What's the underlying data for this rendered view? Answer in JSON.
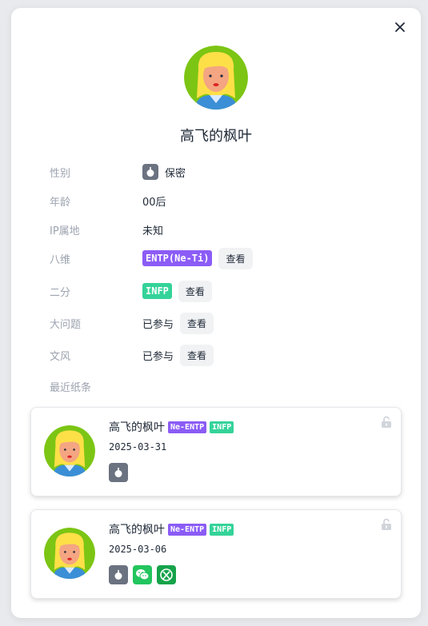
{
  "profile": {
    "username": "高飞的枫叶"
  },
  "info": {
    "gender": {
      "label": "性别",
      "value": "保密"
    },
    "age": {
      "label": "年龄",
      "value": "00后"
    },
    "ip": {
      "label": "IP属地",
      "value": "未知"
    },
    "eight_dim": {
      "label": "八维",
      "tag": "ENTP(Ne-Ti)",
      "button": "查看"
    },
    "binary": {
      "label": "二分",
      "tag": "INFP",
      "button": "查看"
    },
    "big_question": {
      "label": "大问题",
      "value": "已参与",
      "button": "查看"
    },
    "writing_style": {
      "label": "文风",
      "value": "已参与",
      "button": "查看"
    },
    "recent_notes": {
      "label": "最近纸条"
    }
  },
  "notes": [
    {
      "name": "高飞的枫叶",
      "tag1": "Ne-ENTP",
      "tag2": "INFP",
      "date": "2025-03-31",
      "icons": [
        "gender-secret-icon"
      ]
    },
    {
      "name": "高飞的枫叶",
      "tag1": "Ne-ENTP",
      "tag2": "INFP",
      "date": "2025-03-06",
      "icons": [
        "gender-secret-icon",
        "wechat-icon",
        "xbox-icon"
      ]
    }
  ],
  "colors": {
    "purple_tag": "#8b5cf6",
    "green_tag": "#34d399",
    "gender_icon": "#6b7280",
    "wechat": "#22c55e",
    "xbox": "#16a34a"
  }
}
